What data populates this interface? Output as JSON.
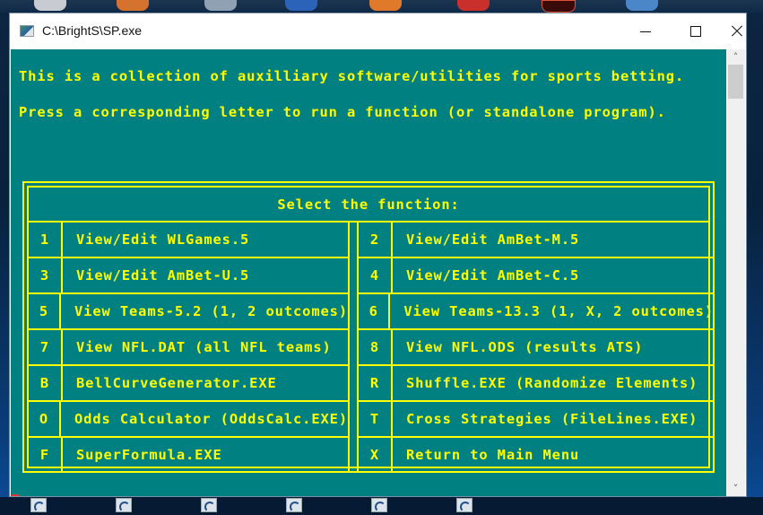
{
  "window": {
    "title": "C:\\BrightS\\SP.exe",
    "controls": {
      "minimize": "minimize",
      "maximize": "maximize",
      "close": "close"
    }
  },
  "console": {
    "intro_line": "This is a collection of auxilliary software/utilities for sports betting.",
    "instruction_line": "Press a corresponding letter to run a function (or standalone program).",
    "menu": {
      "header": "Select the function:",
      "left_items": [
        {
          "key": "1",
          "label": "View/Edit WLGames.5"
        },
        {
          "key": "3",
          "label": "View/Edit AmBet-U.5"
        },
        {
          "key": "5",
          "label": "View Teams-5.2 (1, 2 outcomes)"
        },
        {
          "key": "7",
          "label": "View NFL.DAT (all NFL teams)"
        },
        {
          "key": "B",
          "label": "BellCurveGenerator.EXE"
        },
        {
          "key": "O",
          "label": "Odds Calculator (OddsCalc.EXE)"
        },
        {
          "key": "F",
          "label": "SuperFormula.EXE"
        }
      ],
      "right_items": [
        {
          "key": "2",
          "label": "View/Edit AmBet-M.5"
        },
        {
          "key": "4",
          "label": "View/Edit AmBet-C.5"
        },
        {
          "key": "6",
          "label": "View Teams-13.3 (1, X, 2 outcomes)"
        },
        {
          "key": "8",
          "label": "View NFL.ODS (results ATS)"
        },
        {
          "key": "R",
          "label": "Shuffle.EXE (Randomize Elements)"
        },
        {
          "key": "T",
          "label": "Cross Strategies (FileLines.EXE)"
        },
        {
          "key": "X",
          "label": "Return to Main Menu"
        }
      ]
    }
  },
  "scrollbar": {
    "up_icon": "˄",
    "down_icon": "˅"
  },
  "colors": {
    "console_bg": "#008080",
    "console_text": "#ffff00",
    "titlebar_bg": "#ffffff"
  }
}
